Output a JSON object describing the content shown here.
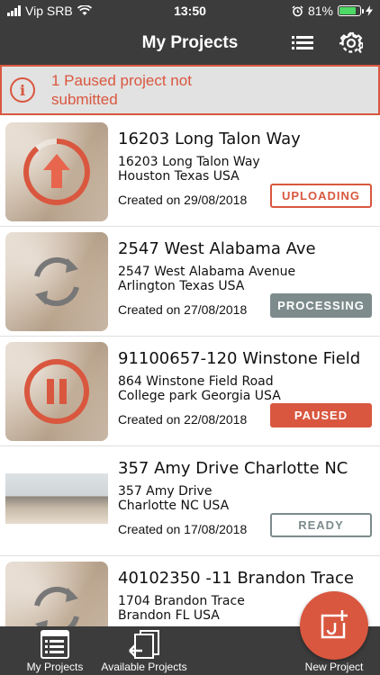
{
  "status_bar": {
    "carrier": "Vip SRB",
    "time": "13:50",
    "battery": "81%",
    "battery_level": 0.81
  },
  "navbar": {
    "title": "My Projects",
    "list_icon": "list-icon",
    "settings_icon": "gear-icon"
  },
  "banner": {
    "message": "1 Paused project not submitted",
    "icon": "info-icon"
  },
  "projects": [
    {
      "name": "16203 Long Talon Way",
      "address_line1": "16203 Long Talon Way",
      "address_line2": "Houston Texas USA",
      "created": "Created on 29/08/2018",
      "status": "UPLOADING",
      "overlay_icon": "upload-progress-icon",
      "progress": 0.85
    },
    {
      "name": "2547 West Alabama Ave",
      "address_line1": "2547 West Alabama Avenue",
      "address_line2": "Arlington Texas USA",
      "created": "Created on 27/08/2018",
      "status": "PROCESSING",
      "overlay_icon": "sync-icon"
    },
    {
      "name": "91100657-120 Winstone Field",
      "address_line1": "864 Winstone Field Road",
      "address_line2": "College park Georgia USA",
      "created": "Created on 22/08/2018",
      "status": "PAUSED",
      "overlay_icon": "pause-icon"
    },
    {
      "name": "357 Amy Drive Charlotte NC",
      "address_line1": "357 Amy Drive",
      "address_line2": "Charlotte NC USA",
      "created": "Created on 17/08/2018",
      "status": "READY",
      "overlay_icon": ""
    },
    {
      "name": "40102350 -11 Brandon Trace",
      "address_line1": "1704 Brandon Trace",
      "address_line2": "Brandon FL USA",
      "created": "",
      "status": "",
      "overlay_icon": "sync-icon"
    }
  ],
  "tab_bar": {
    "my_projects": "My Projects",
    "available_projects": "Available Projects",
    "new_project": "New Project"
  },
  "colors": {
    "accent": "#d9573f",
    "bar": "#3c3c3c",
    "gray_badge": "#7d8b8c",
    "banner_bg": "#e2e2e2"
  }
}
